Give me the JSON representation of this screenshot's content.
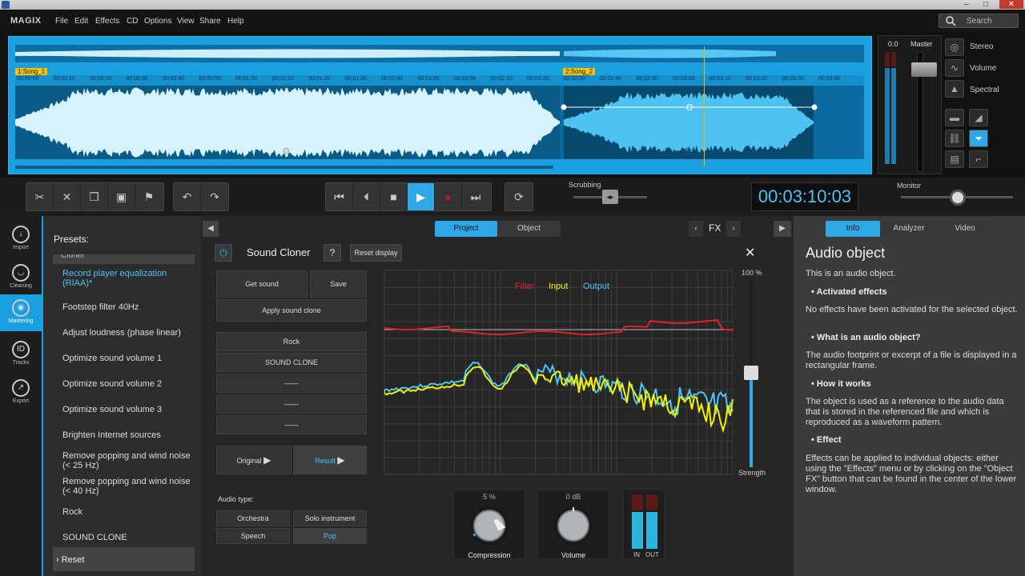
{
  "window": {
    "minimize": "–",
    "maximize": "□",
    "close": "✕"
  },
  "menubar": {
    "brand": "MAGIX",
    "items": [
      "File",
      "Edit",
      "Effects",
      "CD",
      "Options",
      "View",
      "Share",
      "Help"
    ],
    "search_placeholder": "Search"
  },
  "arranger": {
    "objects": [
      {
        "label": "1:Song_1"
      },
      {
        "label": "2:Song_2"
      }
    ],
    "ticks": [
      "00:00:00",
      "00:00:10",
      "00:00:20",
      "00:00:30",
      "00:00:40",
      "00:00:50",
      "00:01:00",
      "00:01:10",
      "00:01:20",
      "00:01:30",
      "00:01:40",
      "00:01:50",
      "00:02:00",
      "00:02:10",
      "00:02:20",
      "00:02:30",
      "00:02:40",
      "00:02:50",
      "00:03:00",
      "00:03:10",
      "00:03:20",
      "00:03:30",
      "00:03:40"
    ]
  },
  "master": {
    "value": "0.0",
    "label": "Master",
    "scale": [
      "+6",
      "0",
      "-10",
      "-20",
      "-30",
      "-40",
      "-50"
    ],
    "views": [
      "Stereo",
      "Volume",
      "Spectral"
    ]
  },
  "transport": {
    "scrubbing": "Scrubbing",
    "monitor": "Monitor",
    "timecode": "00:03:10:03"
  },
  "nav": [
    {
      "label": "Import",
      "icon": "import-icon"
    },
    {
      "label": "Cleaning",
      "icon": "cleaning-icon"
    },
    {
      "label": "Mastering",
      "icon": "mastering-icon",
      "active": true
    },
    {
      "label": "Tracks",
      "icon": "tracks-icon"
    },
    {
      "label": "Export",
      "icon": "export-icon"
    }
  ],
  "presets": {
    "title": "Presets:",
    "cut_item": "Cloner",
    "items": [
      {
        "label": "Record player equalization (RIAA)*",
        "selected": true
      },
      {
        "label": "Footstep filter 40Hz"
      },
      {
        "label": "Adjust loudness (phase linear)"
      },
      {
        "label": "Optimize sound volume 1"
      },
      {
        "label": "Optimize sound volume 2"
      },
      {
        "label": "Optimize sound volume 3"
      },
      {
        "label": "Brighten Internet sources"
      },
      {
        "label": "Remove popping and wind noise (< 25 Hz)"
      },
      {
        "label": "Remove popping and wind noise (< 40 Hz)"
      },
      {
        "label": "Rock"
      },
      {
        "label": "SOUND CLONE"
      }
    ],
    "reset": "Reset"
  },
  "center": {
    "tabs": [
      "Project",
      "Object"
    ],
    "fx": "FX",
    "effect_title": "Sound Cloner",
    "help": "?",
    "reset_display": "Reset display",
    "get_sound": "Get sound",
    "save": "Save",
    "apply": "Apply sound clone",
    "slots": [
      "Rock",
      "SOUND CLONE",
      "——",
      "——",
      "——"
    ],
    "original": "Original",
    "result": "Result",
    "audio_type": "Audio type:",
    "types": [
      "Orchestra",
      "Solo instrument",
      "Speech",
      "Pop"
    ],
    "legend": {
      "filter": "Filter",
      "input": "Input",
      "output": "Output"
    },
    "strength_max": "100 %",
    "strength_label": "Strength",
    "strength_level": 0.5,
    "compression": {
      "value": "5 %",
      "label": "Compression"
    },
    "volume": {
      "value": "0 dB",
      "label": "Volume"
    },
    "io": {
      "in": "IN",
      "out": "OUT"
    },
    "colors": {
      "filter": "#e22222",
      "input": "#f2f200",
      "output": "#4fc3f7",
      "accent": "#2ea8e6"
    }
  },
  "info": {
    "tabs": [
      "Info",
      "Analyzer",
      "Video"
    ],
    "heading": "Audio object",
    "intro": "This is an audio object.",
    "sections": [
      {
        "title": "Activated effects",
        "text": "No effects have been activated for the selected object."
      },
      {
        "title": "What is an audio object?",
        "text": "The audio footprint or excerpt of a file is displayed in a rectangular frame."
      },
      {
        "title": "How it works",
        "text": "The object is used as a reference to the audio data that is stored in the referenced file and which is reproduced as a waveform pattern."
      },
      {
        "title": "Effect",
        "text": "Effects can be applied to individual objects: either using the \"Effects\" menu or by clicking on the \"Object FX\" button that can be found in the center of the lower window."
      }
    ]
  }
}
